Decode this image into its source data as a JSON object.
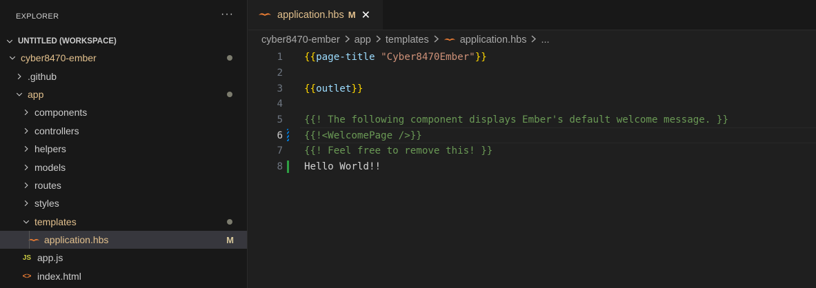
{
  "explorer": {
    "title": "EXPLORER",
    "more": "···",
    "workspace_label": "UNTITLED (WORKSPACE)",
    "tree": [
      {
        "label": "cyber8470-ember",
        "kind": "folder-open",
        "indent": 1,
        "modified": true,
        "dot": true
      },
      {
        "label": ".github",
        "kind": "folder-closed",
        "indent": 2
      },
      {
        "label": "app",
        "kind": "folder-open",
        "indent": 2,
        "modified": true,
        "dot": true
      },
      {
        "label": "components",
        "kind": "folder-closed",
        "indent": 3
      },
      {
        "label": "controllers",
        "kind": "folder-closed",
        "indent": 3
      },
      {
        "label": "helpers",
        "kind": "folder-closed",
        "indent": 3
      },
      {
        "label": "models",
        "kind": "folder-closed",
        "indent": 3
      },
      {
        "label": "routes",
        "kind": "folder-closed",
        "indent": 3
      },
      {
        "label": "styles",
        "kind": "folder-closed",
        "indent": 3
      },
      {
        "label": "templates",
        "kind": "folder-open",
        "indent": 3,
        "modified": true,
        "dot": true
      },
      {
        "label": "application.hbs",
        "kind": "hbs-file",
        "indent": 4,
        "modified": true,
        "badge": "M",
        "selected": true
      },
      {
        "label": "app.js",
        "kind": "js-file",
        "indent": 3,
        "icon_text": "JS"
      },
      {
        "label": "index.html",
        "kind": "html-file",
        "indent": 3,
        "icon_text": "<>"
      }
    ]
  },
  "tab": {
    "label": "application.hbs",
    "badge": "M",
    "close": "✕"
  },
  "breadcrumbs": [
    "cyber8470-ember",
    "app",
    "templates",
    "application.hbs",
    "..."
  ],
  "code_lines": [
    {
      "num": "1",
      "tokens": [
        {
          "t": "{{",
          "c": "t-brace"
        },
        {
          "t": "page-title",
          "c": "t-ident"
        },
        {
          "t": " ",
          "c": "t-plain"
        },
        {
          "t": "\"Cyber8470Ember\"",
          "c": "t-str"
        },
        {
          "t": "}}",
          "c": "t-brace"
        }
      ]
    },
    {
      "num": "2",
      "tokens": []
    },
    {
      "num": "3",
      "tokens": [
        {
          "t": "{{",
          "c": "t-brace"
        },
        {
          "t": "outlet",
          "c": "t-ident"
        },
        {
          "t": "}}",
          "c": "t-brace"
        }
      ]
    },
    {
      "num": "4",
      "tokens": []
    },
    {
      "num": "5",
      "tokens": [
        {
          "t": "{{! The following component displays Ember's default welcome message. }}",
          "c": "t-comment"
        }
      ]
    },
    {
      "num": "6",
      "tokens": [
        {
          "t": "{{!<WelcomePage />}}",
          "c": "t-comment"
        }
      ],
      "active": true,
      "gutter": "modified"
    },
    {
      "num": "7",
      "tokens": [
        {
          "t": "{{! Feel free to remove this! }}",
          "c": "t-comment"
        }
      ]
    },
    {
      "num": "8",
      "tokens": [
        {
          "t": "Hello World!!",
          "c": "t-plain"
        }
      ],
      "gutter": "added"
    }
  ],
  "colors": {
    "accent": "#0078d4",
    "modified": "#e2c08d",
    "gutter_added": "#2ea043",
    "gutter_modified": "#0078d4",
    "hbs_icon": "#e37933"
  }
}
